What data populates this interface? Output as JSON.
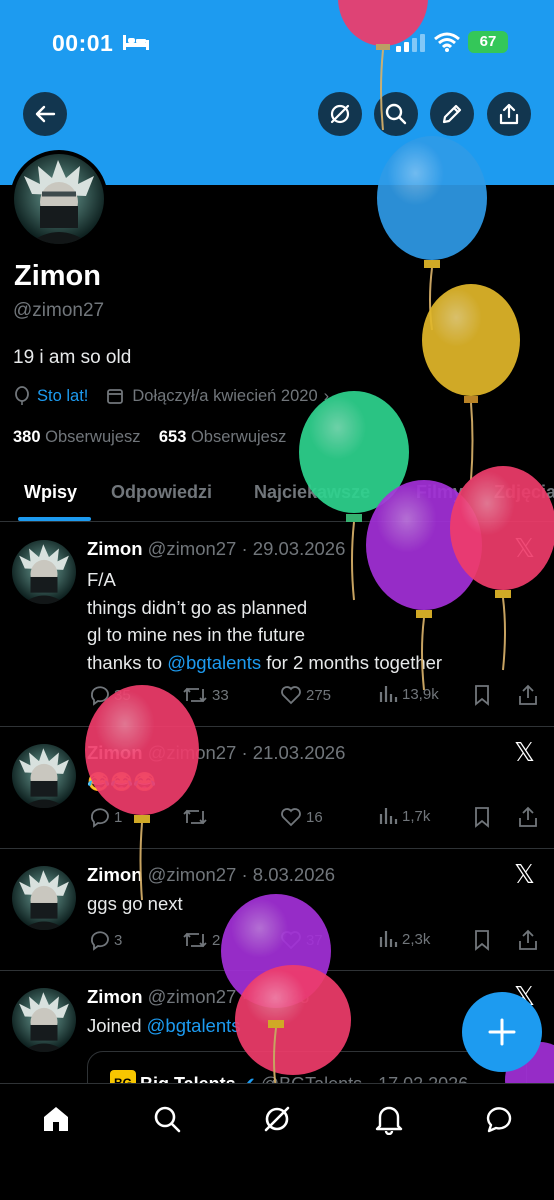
{
  "status_bar": {
    "time": "00:01",
    "battery": "67"
  },
  "header": {
    "buttons": [
      "back",
      "grok",
      "search",
      "edit",
      "share"
    ]
  },
  "profile": {
    "name": "Zimon",
    "handle": "@zimon27",
    "bio": "19 i am so old",
    "birthday_label": "Sto lat!",
    "joined": "Dołączył/a kwiecień 2020",
    "following_count": "380",
    "following_label": "Obserwujesz",
    "followers_count": "653",
    "followers_label": "Obserwujesz"
  },
  "tabs": [
    {
      "label": "Wpisy"
    },
    {
      "label": "Odpowiedzi"
    },
    {
      "label": "Najciekawsze"
    },
    {
      "label": "Filmy"
    },
    {
      "label": "Zdjęcia"
    }
  ],
  "tweets": [
    {
      "name": "Zimon",
      "meta": "@zimon27 · 29.03.2026",
      "lines": [
        "F/A",
        "things didn’t go as planned",
        "gl to mine nes in the future"
      ],
      "last_line_pre": "thanks to ",
      "last_line_mention": "@bgtalents",
      "last_line_post": " for 2 months together",
      "replies": "35",
      "reposts": "33",
      "likes": "275",
      "views": "13,9k"
    },
    {
      "name": "Zimon",
      "meta": "@zimon27 · 21.03.2026",
      "text": "😂😂😂",
      "replies": "1",
      "reposts": "",
      "likes": "16",
      "views": "1,7k"
    },
    {
      "name": "Zimon",
      "meta": "@zimon27 · 8.03.2026",
      "text": "ggs go next",
      "replies": "3",
      "reposts": "2",
      "likes": "37",
      "views": "2,3k"
    },
    {
      "name": "Zimon",
      "meta": "@zimon27 · 2.2026",
      "text_pre": "Joined ",
      "text_mention": "@bgtalents",
      "quote": {
        "name": "Big Talents",
        "meta": "@BGTalents · 17.02.2026",
        "logo_text": "BG"
      }
    }
  ],
  "x_logo": "𝕏",
  "fab_icon": "plus-icon",
  "nav": [
    "home",
    "search",
    "grok",
    "notifications",
    "messages"
  ],
  "colors": {
    "accent": "#1d9bf0",
    "banner": "#1d9bf0",
    "muted": "#71767b",
    "divider": "#2f3336",
    "balloon_pink": "#ef3c6b",
    "balloon_blue": "#2f9be8",
    "balloon_yellow": "#e2b82a",
    "balloon_green": "#2ed48f",
    "balloon_purple": "#a330d8"
  }
}
